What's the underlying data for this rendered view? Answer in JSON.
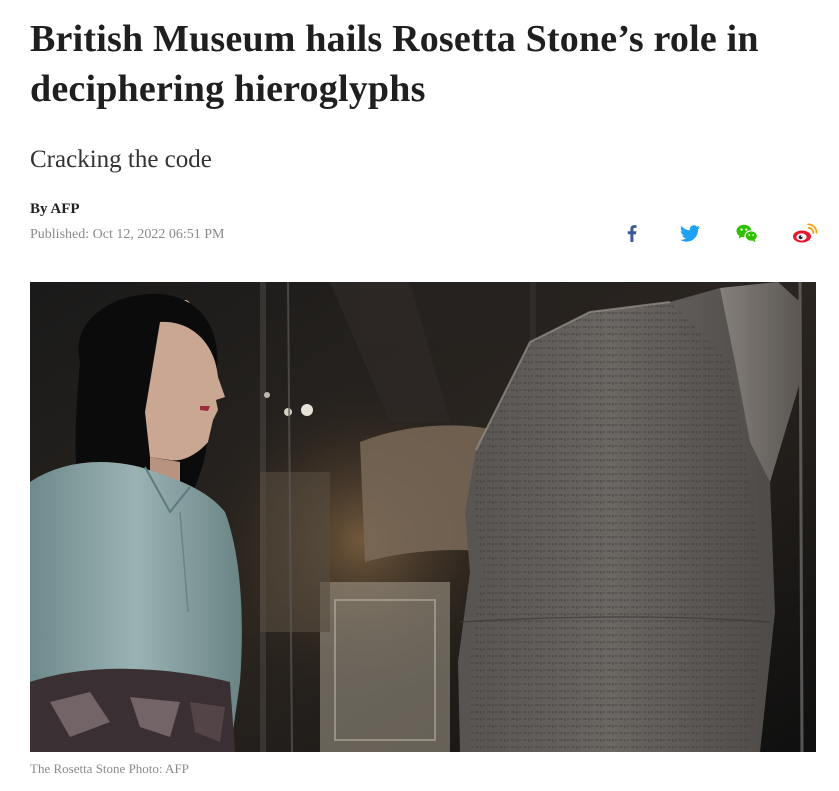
{
  "article": {
    "headline": "British Museum hails Rosetta Stone’s role in deciphering hieroglyphs",
    "subtitle": "Cracking the code",
    "byline": "By AFP",
    "published": "Published: Oct 12, 2022 06:51 PM"
  },
  "share": {
    "buttons": [
      {
        "icon": "facebook-icon",
        "color": "#3b5998"
      },
      {
        "icon": "twitter-icon",
        "color": "#1da1f2"
      },
      {
        "icon": "wechat-icon",
        "color": "#2dc100"
      },
      {
        "icon": "weibo-icon",
        "color": "#e6162d"
      }
    ]
  },
  "photo": {
    "caption": "The Rosetta Stone Photo: AFP"
  }
}
